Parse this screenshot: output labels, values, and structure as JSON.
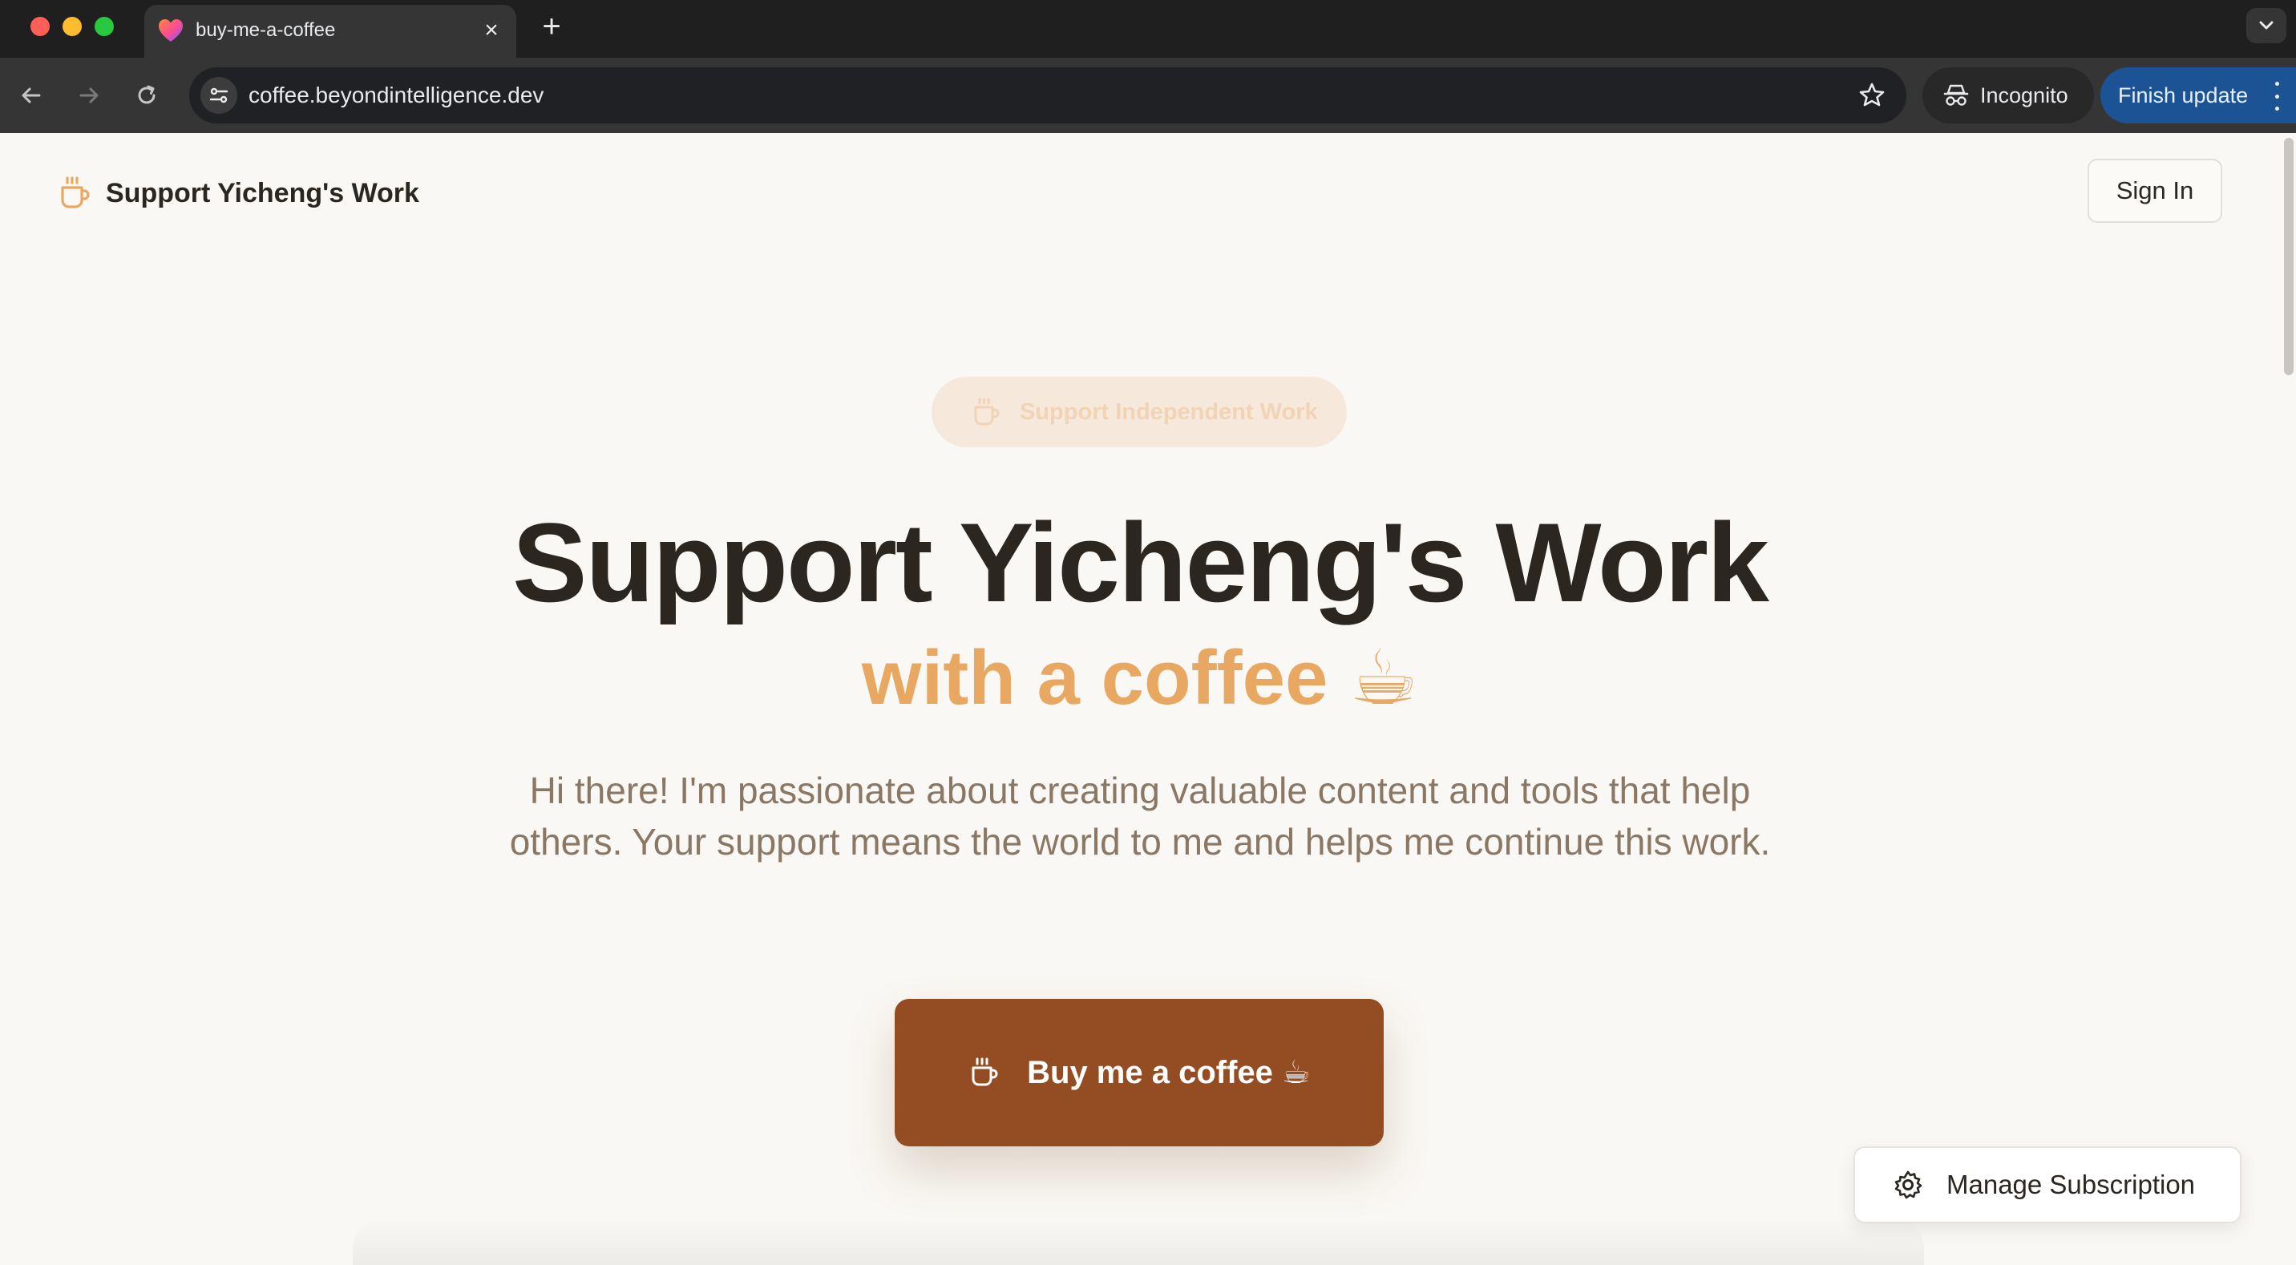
{
  "browser": {
    "tab_title": "buy-me-a-coffee",
    "url": "coffee.beyondintelligence.dev",
    "incognito_label": "Incognito",
    "finish_update_label": "Finish update",
    "new_tab_symbol": "+",
    "close_symbol": "×",
    "icons": [
      "back-icon",
      "forward-icon",
      "reload-icon",
      "site-info-icon",
      "star-icon",
      "incognito-icon",
      "menu-icon",
      "tab-dropdown-icon"
    ]
  },
  "header": {
    "brand_name": "Support Yicheng's Work",
    "sign_in_label": "Sign In"
  },
  "hero": {
    "pill_label": "Support Independent Work",
    "title": "Support Yicheng's Work",
    "subtitle": "with a coffee",
    "subtitle_emoji": "☕",
    "intro": "Hi there! I'm passionate about creating valuable content and tools that help others. Your support means the world to me and helps me continue this work.",
    "cta_label": "Buy me a coffee ☕"
  },
  "floating": {
    "manage_label": "Manage Subscription"
  },
  "colors": {
    "accent": "#e8a862",
    "cta": "#944d22",
    "text": "#2b2620",
    "muted_text": "#8a7764",
    "page_bg": "#faf8f4",
    "update_button": "#1b5395"
  }
}
